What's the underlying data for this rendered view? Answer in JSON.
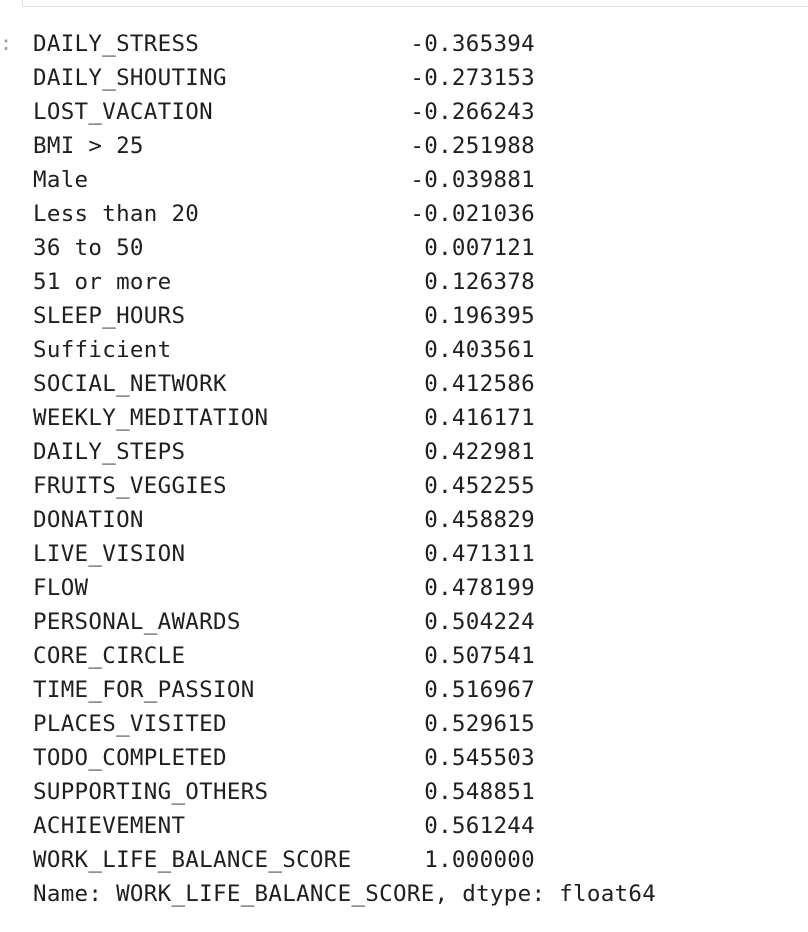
{
  "cell": {
    "prompt_marker": ":"
  },
  "series": {
    "rows": [
      {
        "label": "DAILY_STRESS",
        "value": "-0.365394"
      },
      {
        "label": "DAILY_SHOUTING",
        "value": "-0.273153"
      },
      {
        "label": "LOST_VACATION",
        "value": "-0.266243"
      },
      {
        "label": "BMI > 25",
        "value": "-0.251988"
      },
      {
        "label": "Male",
        "value": "-0.039881"
      },
      {
        "label": "Less than 20",
        "value": "-0.021036"
      },
      {
        "label": "36 to 50",
        "value": "0.007121"
      },
      {
        "label": "51 or more",
        "value": "0.126378"
      },
      {
        "label": "SLEEP_HOURS",
        "value": "0.196395"
      },
      {
        "label": "Sufficient",
        "value": "0.403561"
      },
      {
        "label": "SOCIAL_NETWORK",
        "value": "0.412586"
      },
      {
        "label": "WEEKLY_MEDITATION",
        "value": "0.416171"
      },
      {
        "label": "DAILY_STEPS",
        "value": "0.422981"
      },
      {
        "label": "FRUITS_VEGGIES",
        "value": "0.452255"
      },
      {
        "label": "DONATION",
        "value": "0.458829"
      },
      {
        "label": "LIVE_VISION",
        "value": "0.471311"
      },
      {
        "label": "FLOW",
        "value": "0.478199"
      },
      {
        "label": "PERSONAL_AWARDS",
        "value": "0.504224"
      },
      {
        "label": "CORE_CIRCLE",
        "value": "0.507541"
      },
      {
        "label": "TIME_FOR_PASSION",
        "value": "0.516967"
      },
      {
        "label": "PLACES_VISITED",
        "value": "0.529615"
      },
      {
        "label": "TODO_COMPLETED",
        "value": "0.545503"
      },
      {
        "label": "SUPPORTING_OTHERS",
        "value": "0.548851"
      },
      {
        "label": "ACHIEVEMENT",
        "value": "0.561244"
      },
      {
        "label": "WORK_LIFE_BALANCE_SCORE",
        "value": "1.000000"
      }
    ],
    "footer": "Name: WORK_LIFE_BALANCE_SCORE, dtype: float64"
  }
}
